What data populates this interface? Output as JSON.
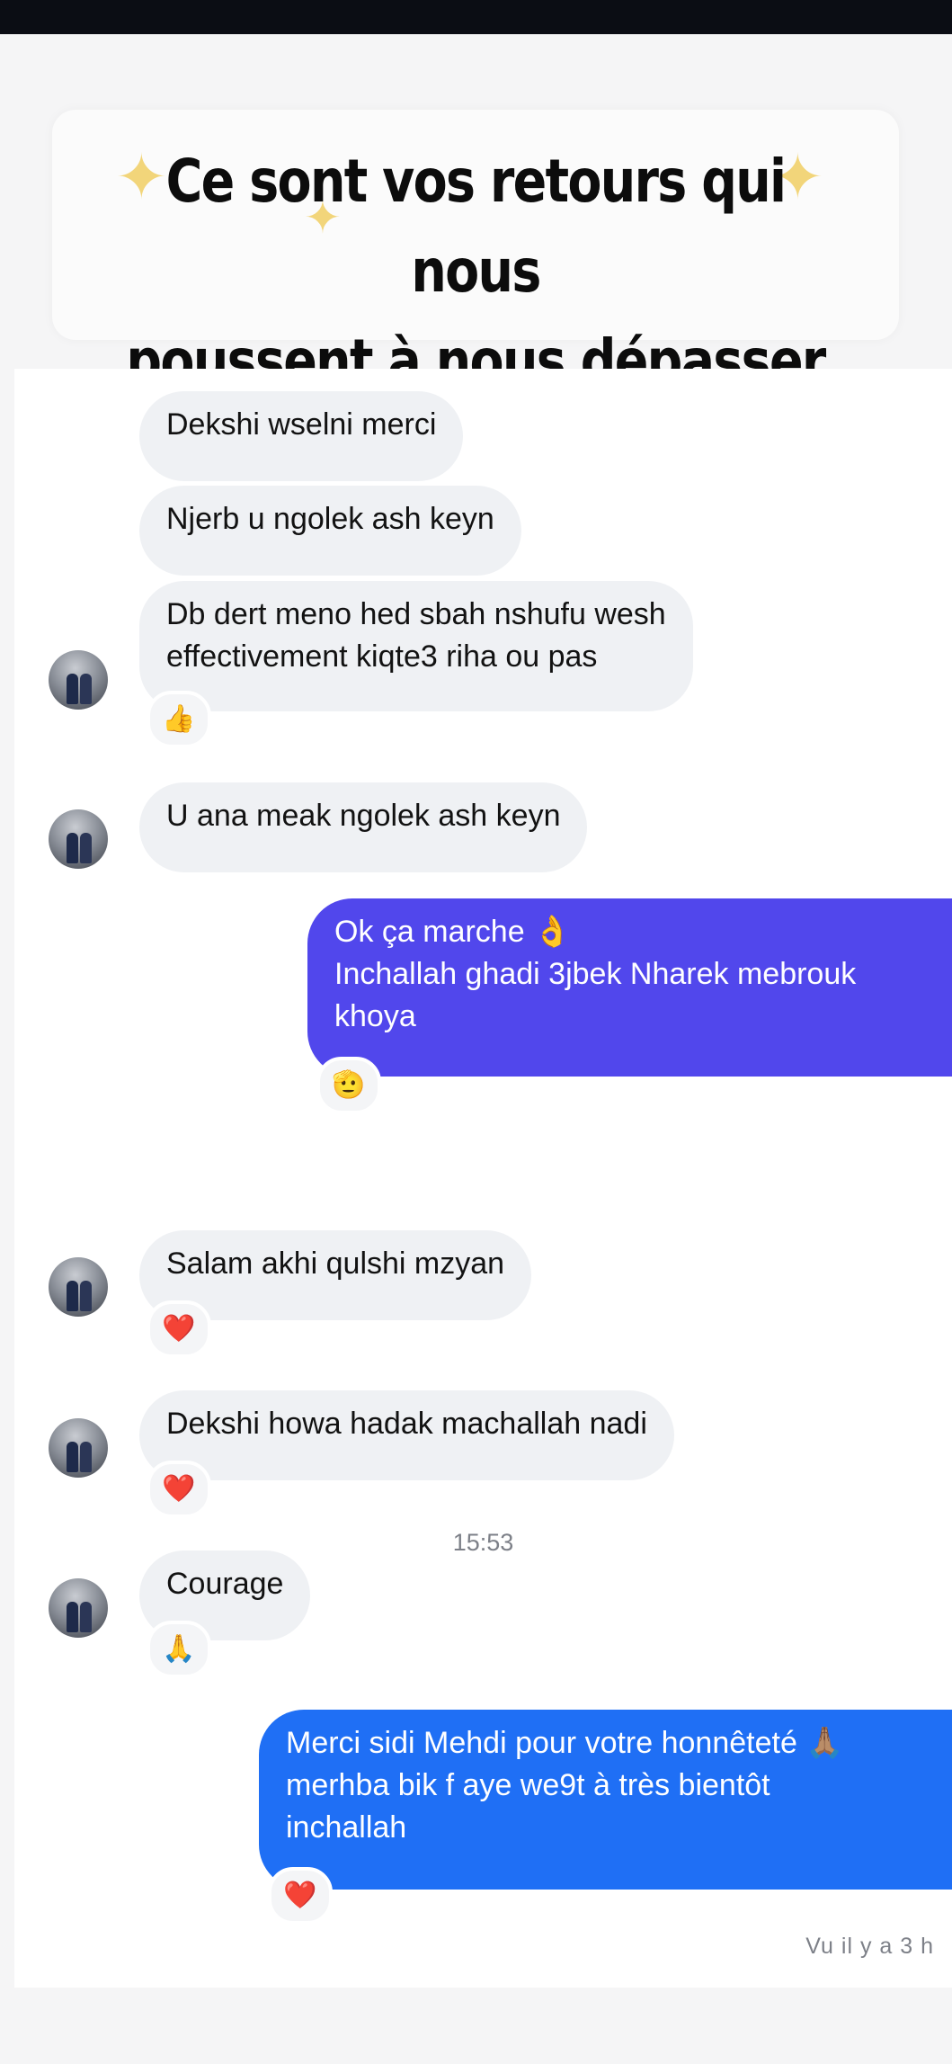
{
  "banner": {
    "line1": "Ce sont vos retours qui nous",
    "line2": "poussent à nous dépasser 🥰"
  },
  "messages": [
    {
      "from": "them",
      "text": "Dekshi wselni merci"
    },
    {
      "from": "them",
      "text": "Njerb u ngolek ash keyn"
    },
    {
      "from": "them",
      "line1": "Db dert meno hed sbah nshufu wesh",
      "line2": "effectivement kiqte3 riha ou pas",
      "reaction": "👍"
    },
    {
      "from": "them",
      "text": "U ana meak ngolek ash keyn"
    },
    {
      "from": "me",
      "line1": "Ok ça marche 👌",
      "line2": "Inchallah ghadi 3jbek Nharek mebrouk",
      "line3": "khoya",
      "reaction": "🫡"
    },
    {
      "from": "them",
      "text": "Salam akhi qulshi mzyan",
      "reaction": "❤️"
    },
    {
      "from": "them",
      "text": "Dekshi howa hadak machallah nadi",
      "reaction": "❤️"
    },
    {
      "from": "them",
      "text": "Courage",
      "reaction": "🙏"
    },
    {
      "from": "me",
      "line1": "Merci sidi Mehdi pour votre honnêteté 🙏🏽",
      "line2": "merhba bik f aye we9t à très bientôt",
      "line3": "inchallah",
      "reaction": "❤️"
    }
  ],
  "timestamp": "15:53",
  "seen_status": "Vu il y a 3 h",
  "colors": {
    "incoming_bubble": "#eff1f4",
    "outgoing_purple": "#5147ec",
    "outgoing_blue": "#1f6ff5",
    "heart": "#e5202e"
  }
}
